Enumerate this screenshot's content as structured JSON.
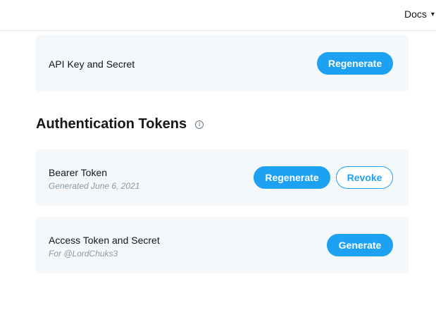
{
  "topbar": {
    "docs_label": "Docs"
  },
  "api_key_card": {
    "title": "API Key and Secret",
    "button": "Regenerate"
  },
  "auth_section": {
    "title": "Authentication Tokens"
  },
  "bearer_card": {
    "title": "Bearer Token",
    "subtitle": "Generated June 6, 2021",
    "regenerate_button": "Regenerate",
    "revoke_button": "Revoke"
  },
  "access_card": {
    "title": "Access Token and Secret",
    "subtitle": "For @LordChuks3",
    "button": "Generate"
  },
  "colors": {
    "accent": "#1da1f2",
    "card_bg": "#f5f8fa",
    "muted": "#8899a6"
  }
}
